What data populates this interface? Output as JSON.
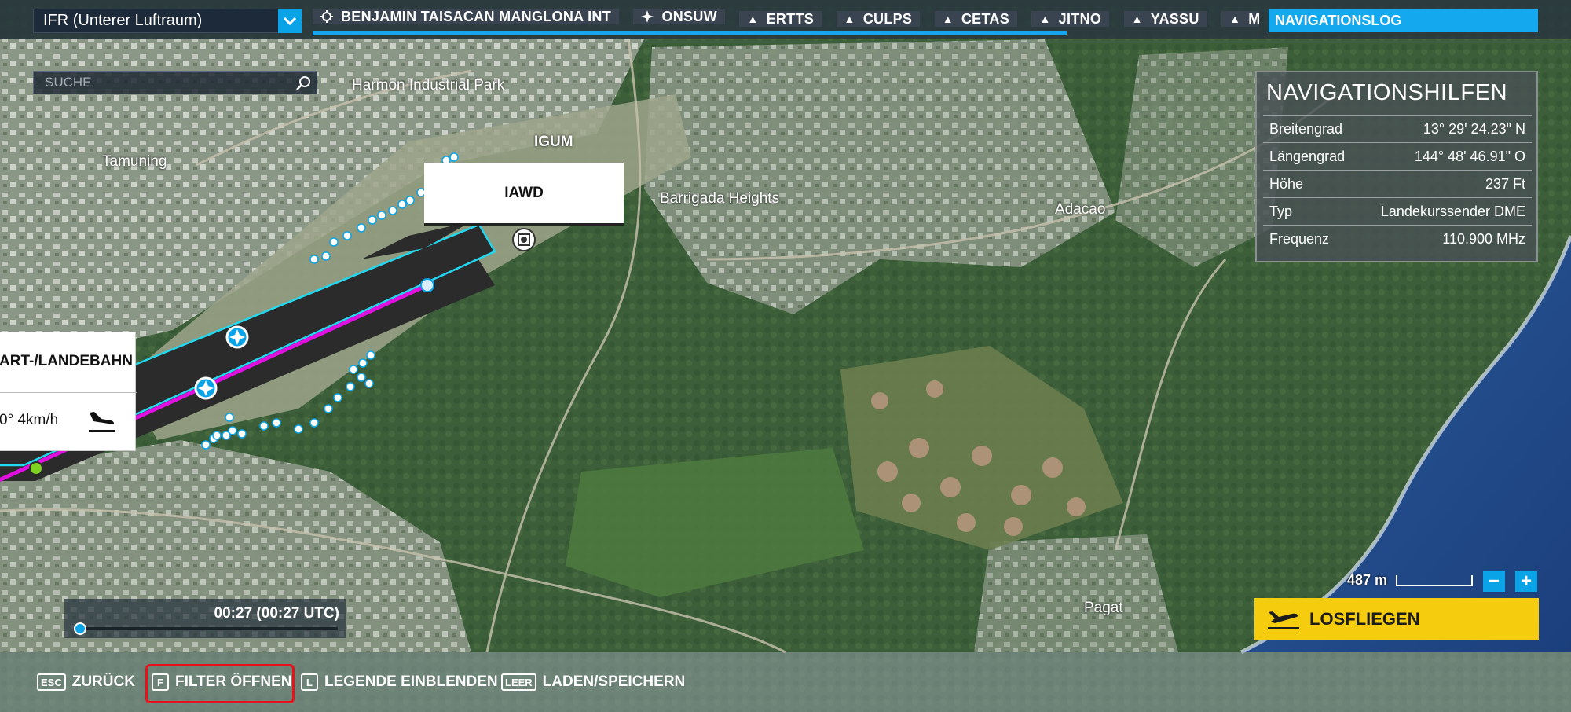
{
  "topbar": {
    "flight_rule": "IFR (Unterer Luftraum)",
    "waypoints": [
      {
        "icon": "airport-icon",
        "label": "BENJAMIN TAISACAN MANGLONA INT"
      },
      {
        "icon": "vor-icon",
        "label": "ONSUW"
      },
      {
        "icon": "waypoint-triangle-icon",
        "label": "ERTTS"
      },
      {
        "icon": "waypoint-triangle-icon",
        "label": "CULPS"
      },
      {
        "icon": "waypoint-triangle-icon",
        "label": "CETAS"
      },
      {
        "icon": "waypoint-triangle-icon",
        "label": "JITNO"
      },
      {
        "icon": "waypoint-triangle-icon",
        "label": "YASSU"
      },
      {
        "icon": "waypoint-triangle-icon",
        "label": "M"
      }
    ],
    "navlog_label": "NAVIGATIONSLOG"
  },
  "search": {
    "placeholder": "SUCHE"
  },
  "navaids": {
    "title": "NAVIGATIONSHILFEN",
    "rows": [
      {
        "key": "Breitengrad",
        "value": "13° 29' 24.23\" N"
      },
      {
        "key": "Längengrad",
        "value": "144° 48' 46.91\" O"
      },
      {
        "key": "Höhe",
        "value": "237 Ft"
      },
      {
        "key": "Typ",
        "value": "Landekurssender DME"
      },
      {
        "key": "Frequenz",
        "value": "110.900 MHz"
      }
    ]
  },
  "map": {
    "labels": {
      "harmon": "Harmon Industrial Park",
      "tamuning": "Tamuning",
      "igum": "IGUM",
      "barrigada": "Barrigada Heights",
      "adacao": "Adacao",
      "pagat": "Pagat"
    },
    "iawd_tag": "IAWD"
  },
  "runway_card": {
    "title": "ART-/LANDEBAHN",
    "wind": "0° 4km/h"
  },
  "scale": {
    "label": "487 m"
  },
  "zoom": {
    "minus": "−",
    "plus": "+"
  },
  "fly_button": {
    "label": "LOSFLIEGEN"
  },
  "time": {
    "value": "00:27 (00:27 UTC)",
    "slider_fraction": 0.0
  },
  "bottombar": {
    "hints": [
      {
        "key": "ESC",
        "label": "ZURÜCK"
      },
      {
        "key": "F",
        "label": "FILTER ÖFFNEN"
      },
      {
        "key": "L",
        "label": "LEGENDE EINBLENDEN"
      },
      {
        "key": "LEER",
        "label": "LADEN/SPEICHERN"
      }
    ]
  },
  "colors": {
    "accent": "#0AA3E8",
    "fly_button": "#F5CC0E",
    "route_line": "#E010E0",
    "runway_outline": "#22D8F0",
    "highlight": "#E8101A"
  }
}
